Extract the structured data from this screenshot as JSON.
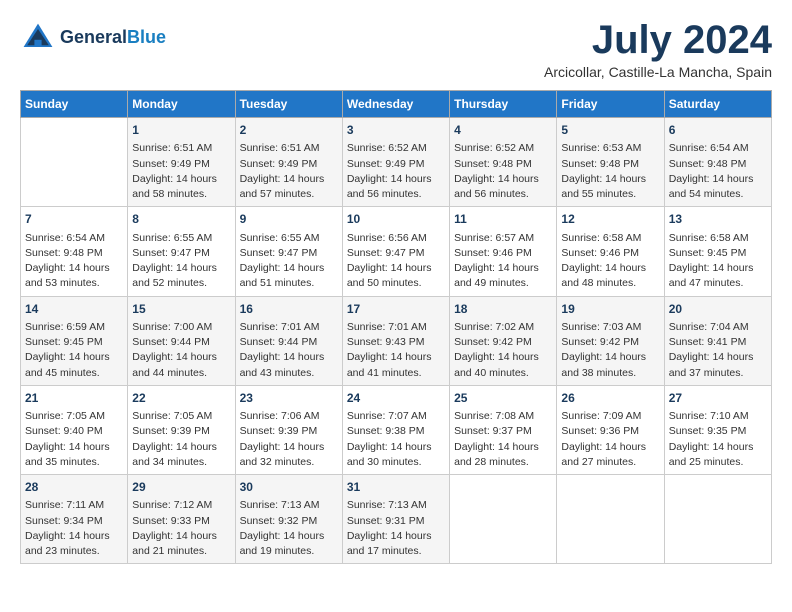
{
  "header": {
    "logo_line1": "General",
    "logo_line2": "Blue",
    "month_title": "July 2024",
    "subtitle": "Arcicollar, Castille-La Mancha, Spain"
  },
  "days_of_week": [
    "Sunday",
    "Monday",
    "Tuesday",
    "Wednesday",
    "Thursday",
    "Friday",
    "Saturday"
  ],
  "weeks": [
    [
      {
        "day": "",
        "info": ""
      },
      {
        "day": "1",
        "info": "Sunrise: 6:51 AM\nSunset: 9:49 PM\nDaylight: 14 hours\nand 58 minutes."
      },
      {
        "day": "2",
        "info": "Sunrise: 6:51 AM\nSunset: 9:49 PM\nDaylight: 14 hours\nand 57 minutes."
      },
      {
        "day": "3",
        "info": "Sunrise: 6:52 AM\nSunset: 9:49 PM\nDaylight: 14 hours\nand 56 minutes."
      },
      {
        "day": "4",
        "info": "Sunrise: 6:52 AM\nSunset: 9:48 PM\nDaylight: 14 hours\nand 56 minutes."
      },
      {
        "day": "5",
        "info": "Sunrise: 6:53 AM\nSunset: 9:48 PM\nDaylight: 14 hours\nand 55 minutes."
      },
      {
        "day": "6",
        "info": "Sunrise: 6:54 AM\nSunset: 9:48 PM\nDaylight: 14 hours\nand 54 minutes."
      }
    ],
    [
      {
        "day": "7",
        "info": "Sunrise: 6:54 AM\nSunset: 9:48 PM\nDaylight: 14 hours\nand 53 minutes."
      },
      {
        "day": "8",
        "info": "Sunrise: 6:55 AM\nSunset: 9:47 PM\nDaylight: 14 hours\nand 52 minutes."
      },
      {
        "day": "9",
        "info": "Sunrise: 6:55 AM\nSunset: 9:47 PM\nDaylight: 14 hours\nand 51 minutes."
      },
      {
        "day": "10",
        "info": "Sunrise: 6:56 AM\nSunset: 9:47 PM\nDaylight: 14 hours\nand 50 minutes."
      },
      {
        "day": "11",
        "info": "Sunrise: 6:57 AM\nSunset: 9:46 PM\nDaylight: 14 hours\nand 49 minutes."
      },
      {
        "day": "12",
        "info": "Sunrise: 6:58 AM\nSunset: 9:46 PM\nDaylight: 14 hours\nand 48 minutes."
      },
      {
        "day": "13",
        "info": "Sunrise: 6:58 AM\nSunset: 9:45 PM\nDaylight: 14 hours\nand 47 minutes."
      }
    ],
    [
      {
        "day": "14",
        "info": "Sunrise: 6:59 AM\nSunset: 9:45 PM\nDaylight: 14 hours\nand 45 minutes."
      },
      {
        "day": "15",
        "info": "Sunrise: 7:00 AM\nSunset: 9:44 PM\nDaylight: 14 hours\nand 44 minutes."
      },
      {
        "day": "16",
        "info": "Sunrise: 7:01 AM\nSunset: 9:44 PM\nDaylight: 14 hours\nand 43 minutes."
      },
      {
        "day": "17",
        "info": "Sunrise: 7:01 AM\nSunset: 9:43 PM\nDaylight: 14 hours\nand 41 minutes."
      },
      {
        "day": "18",
        "info": "Sunrise: 7:02 AM\nSunset: 9:42 PM\nDaylight: 14 hours\nand 40 minutes."
      },
      {
        "day": "19",
        "info": "Sunrise: 7:03 AM\nSunset: 9:42 PM\nDaylight: 14 hours\nand 38 minutes."
      },
      {
        "day": "20",
        "info": "Sunrise: 7:04 AM\nSunset: 9:41 PM\nDaylight: 14 hours\nand 37 minutes."
      }
    ],
    [
      {
        "day": "21",
        "info": "Sunrise: 7:05 AM\nSunset: 9:40 PM\nDaylight: 14 hours\nand 35 minutes."
      },
      {
        "day": "22",
        "info": "Sunrise: 7:05 AM\nSunset: 9:39 PM\nDaylight: 14 hours\nand 34 minutes."
      },
      {
        "day": "23",
        "info": "Sunrise: 7:06 AM\nSunset: 9:39 PM\nDaylight: 14 hours\nand 32 minutes."
      },
      {
        "day": "24",
        "info": "Sunrise: 7:07 AM\nSunset: 9:38 PM\nDaylight: 14 hours\nand 30 minutes."
      },
      {
        "day": "25",
        "info": "Sunrise: 7:08 AM\nSunset: 9:37 PM\nDaylight: 14 hours\nand 28 minutes."
      },
      {
        "day": "26",
        "info": "Sunrise: 7:09 AM\nSunset: 9:36 PM\nDaylight: 14 hours\nand 27 minutes."
      },
      {
        "day": "27",
        "info": "Sunrise: 7:10 AM\nSunset: 9:35 PM\nDaylight: 14 hours\nand 25 minutes."
      }
    ],
    [
      {
        "day": "28",
        "info": "Sunrise: 7:11 AM\nSunset: 9:34 PM\nDaylight: 14 hours\nand 23 minutes."
      },
      {
        "day": "29",
        "info": "Sunrise: 7:12 AM\nSunset: 9:33 PM\nDaylight: 14 hours\nand 21 minutes."
      },
      {
        "day": "30",
        "info": "Sunrise: 7:13 AM\nSunset: 9:32 PM\nDaylight: 14 hours\nand 19 minutes."
      },
      {
        "day": "31",
        "info": "Sunrise: 7:13 AM\nSunset: 9:31 PM\nDaylight: 14 hours\nand 17 minutes."
      },
      {
        "day": "",
        "info": ""
      },
      {
        "day": "",
        "info": ""
      },
      {
        "day": "",
        "info": ""
      }
    ]
  ]
}
